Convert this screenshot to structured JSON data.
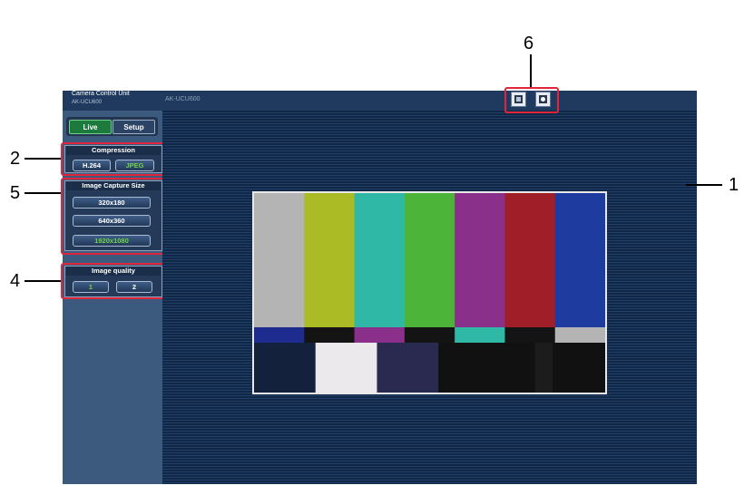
{
  "header": {
    "app_title": "Camera Control Unit",
    "model": "AK-UCU600",
    "camera_label": "AK-UCU600"
  },
  "tabs": {
    "live": "Live",
    "setup": "Setup",
    "active": "live"
  },
  "compression": {
    "title": "Compression",
    "options": [
      "H.264",
      "JPEG"
    ],
    "selected": "JPEG"
  },
  "capture_size": {
    "title": "Image Capture Size",
    "options": [
      "320x180",
      "640x360",
      "1920x1080"
    ],
    "selected": "1920x1080"
  },
  "quality": {
    "title": "Image quality",
    "options": [
      "1",
      "2"
    ],
    "selected": "1"
  },
  "toolbar_icons": [
    "screen-capture-icon",
    "snapshot-camera-icon"
  ],
  "callouts": {
    "c1": "1",
    "c2": "2",
    "c4": "4",
    "c5": "5",
    "c6": "6"
  },
  "colors": {
    "highlight": "#e0263a",
    "active_text": "#6fd24a",
    "bars_top": [
      "#b4b4b4",
      "#abbb26",
      "#2fb8a6",
      "#4db43a",
      "#8a2f8a",
      "#a01e28",
      "#1e3ca0"
    ],
    "bars_mid": [
      "#1e2c90",
      "#141414",
      "#8a2f8a",
      "#141414",
      "#2fb8a6",
      "#141414",
      "#b4b4b4"
    ],
    "bars_bottom": [
      "#14213c",
      "#ece9ec",
      "#2a2a50",
      "#111111",
      "#111111",
      "#111111",
      "#1c1c1c",
      "#111111"
    ]
  }
}
